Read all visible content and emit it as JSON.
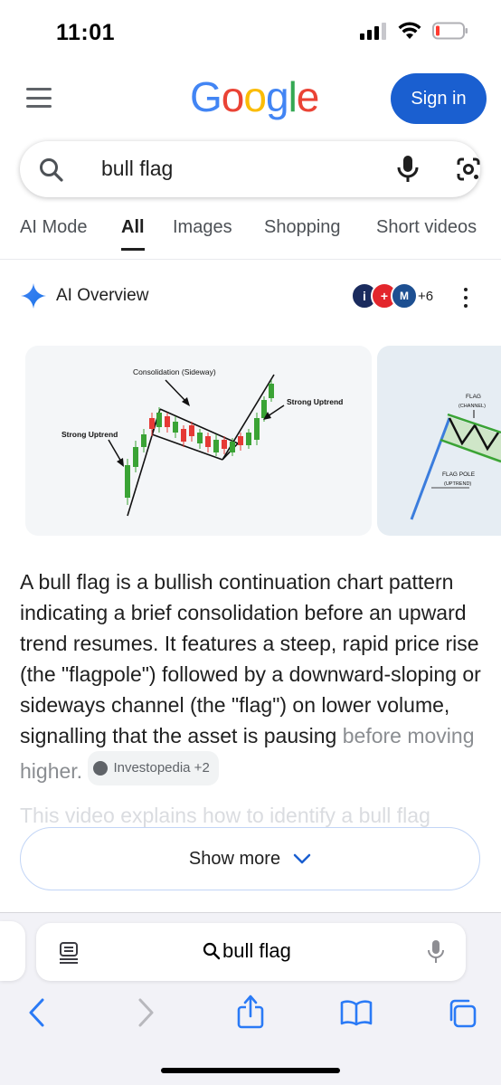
{
  "status_bar": {
    "time": "11:01"
  },
  "header": {
    "logo": [
      "G",
      "o",
      "o",
      "g",
      "l",
      "e"
    ],
    "logo_colors": [
      "#4285F4",
      "#EA4335",
      "#FBBC05",
      "#4285F4",
      "#34A853",
      "#EA4335"
    ],
    "sign_in_label": "Sign in"
  },
  "search": {
    "query": "bull flag"
  },
  "tabs": [
    {
      "label": "AI Mode"
    },
    {
      "label": "All",
      "active": true
    },
    {
      "label": "Images"
    },
    {
      "label": "Shopping"
    },
    {
      "label": "Short videos"
    }
  ],
  "ai_overview": {
    "title": "AI Overview",
    "sources_more": "+6",
    "images": [
      {
        "labels": {
          "consolidation": "Consolidation (Sideway)",
          "strong_uptrend_left": "Strong Uptrend",
          "strong_uptrend_right": "Strong Uptrend"
        }
      },
      {
        "labels": {
          "flag": "FLAG",
          "channel": "(CHANNEL)",
          "flag_pole": "FLAG POLE",
          "uptrend": "(UPTREND)"
        }
      }
    ],
    "paragraph_main": "A bull flag is a bullish continuation chart pattern indicating a brief consolidation before an upward trend resumes. It features a steep, rapid price rise (the \"flagpole\") followed by a downward-sloping or sideways channel (the \"flag\") on lower volume, signalling that the asset is pausing",
    "paragraph_fade": "before moving higher.",
    "citation_chip": "Investopedia +2",
    "ghost_text": "This video explains how to identify a bull flag",
    "show_more_label": "Show more"
  },
  "safari": {
    "url_text": "bull flag"
  }
}
